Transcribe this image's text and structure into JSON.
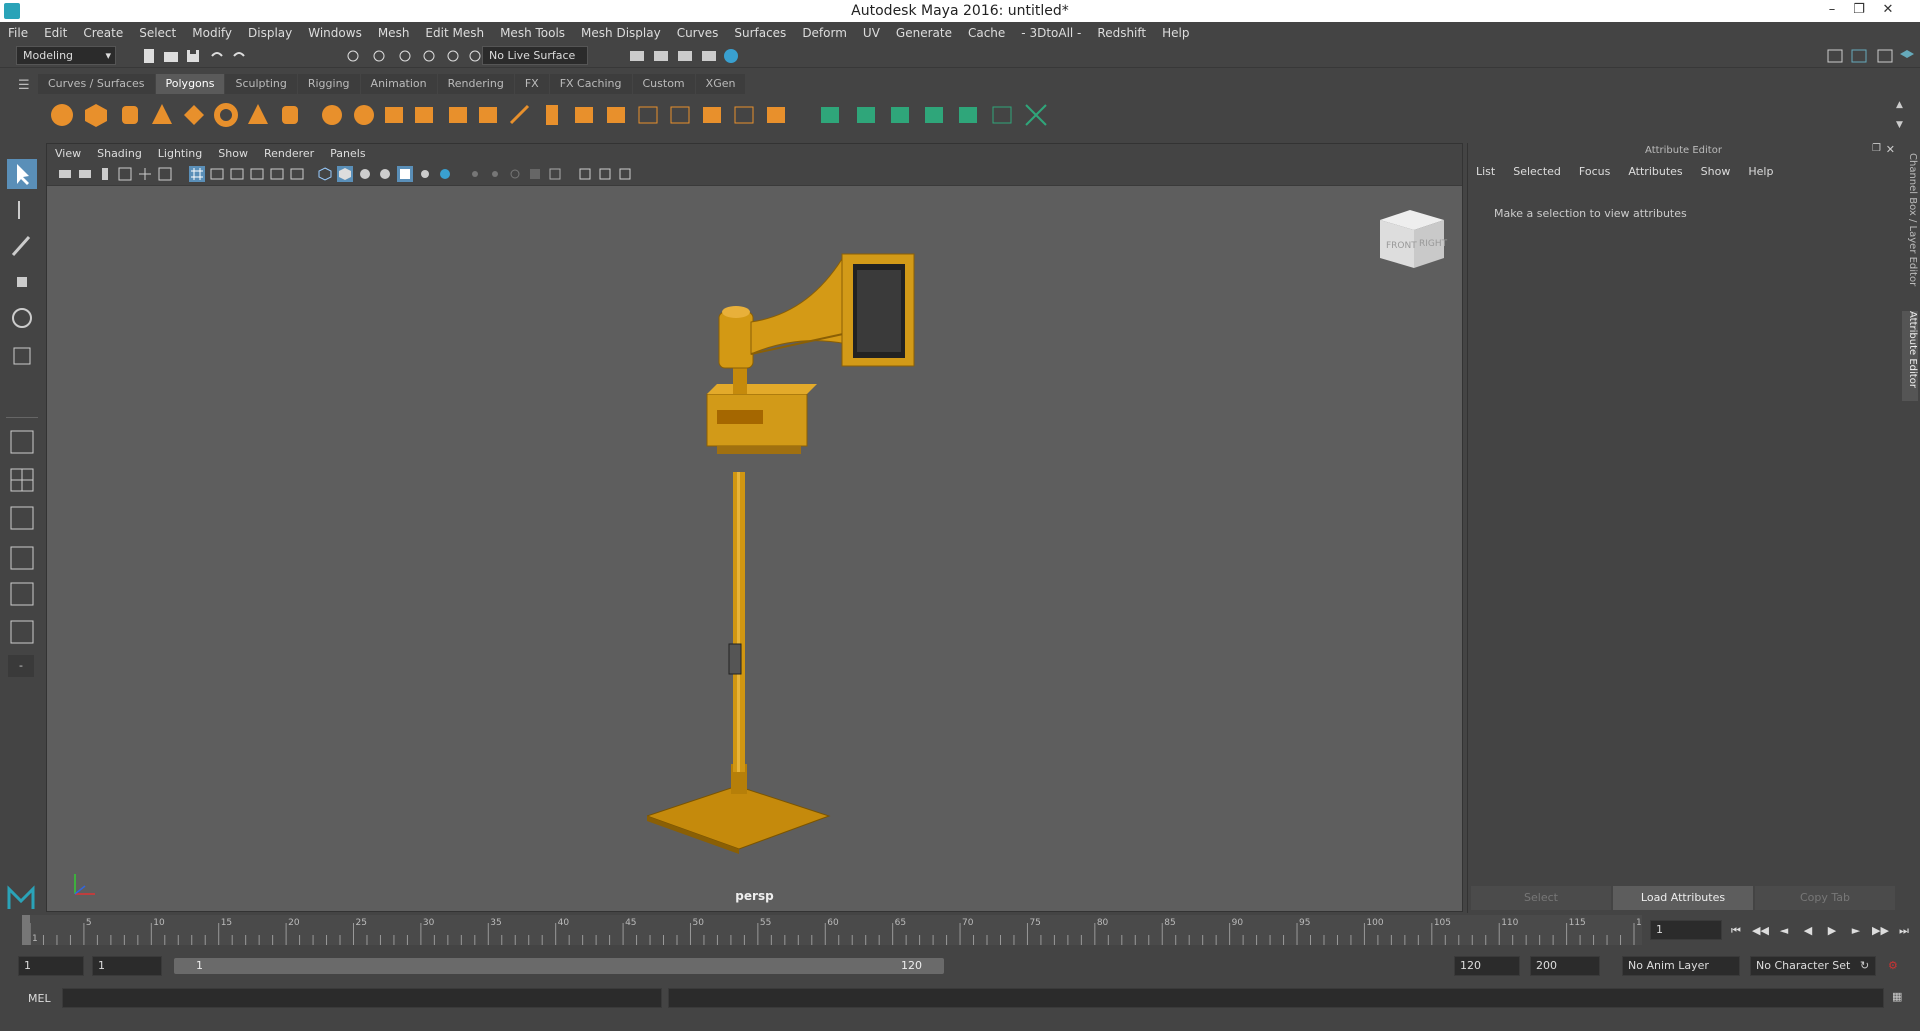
{
  "window": {
    "title": "Autodesk Maya 2016: untitled*"
  },
  "menubar": [
    "File",
    "Edit",
    "Create",
    "Select",
    "Modify",
    "Display",
    "Windows",
    "Mesh",
    "Edit Mesh",
    "Mesh Tools",
    "Mesh Display",
    "Curves",
    "Surfaces",
    "Deform",
    "UV",
    "Generate",
    "Cache",
    "- 3DtoAll -",
    "Redshift",
    "Help"
  ],
  "statusline": {
    "mode": "Modeling",
    "live_surface": "No Live Surface"
  },
  "shelf": {
    "tabs": [
      "Curves / Surfaces",
      "Polygons",
      "Sculpting",
      "Rigging",
      "Animation",
      "Rendering",
      "FX",
      "FX Caching",
      "Custom",
      "XGen"
    ],
    "active": "Polygons"
  },
  "viewport": {
    "menu": [
      "View",
      "Shading",
      "Lighting",
      "Show",
      "Renderer",
      "Panels"
    ],
    "camera": "persp",
    "viewcube": {
      "front": "FRONT",
      "right": "RIGHT"
    }
  },
  "attribute_editor": {
    "title": "Attribute Editor",
    "menu": [
      "List",
      "Selected",
      "Focus",
      "Attributes",
      "Show",
      "Help"
    ],
    "message": "Make a selection to view attributes",
    "buttons": [
      "Select",
      "Load Attributes",
      "Copy Tab"
    ]
  },
  "side_tabs": [
    "Channel Box / Layer Editor",
    "Attribute Editor"
  ],
  "timeline": {
    "ticks": [
      "1",
      "5",
      "10",
      "15",
      "20",
      "25",
      "30",
      "35",
      "40",
      "45",
      "50",
      "55",
      "60",
      "65",
      "70",
      "75",
      "80",
      "85",
      "90",
      "95",
      "100",
      "105",
      "110",
      "115",
      "120"
    ],
    "current_frame": "1"
  },
  "range": {
    "start": "1",
    "playback_start": "1",
    "slider_start": "1",
    "slider_end": "120",
    "playback_end": "120",
    "end": "200",
    "anim_layer": "No Anim Layer",
    "character_set": "No Character Set"
  },
  "cmdline": {
    "label": "MEL"
  },
  "colors": {
    "accent": "#2aa3b8",
    "model": "#c9920a",
    "viewport_bg": "#5e5e5e"
  }
}
